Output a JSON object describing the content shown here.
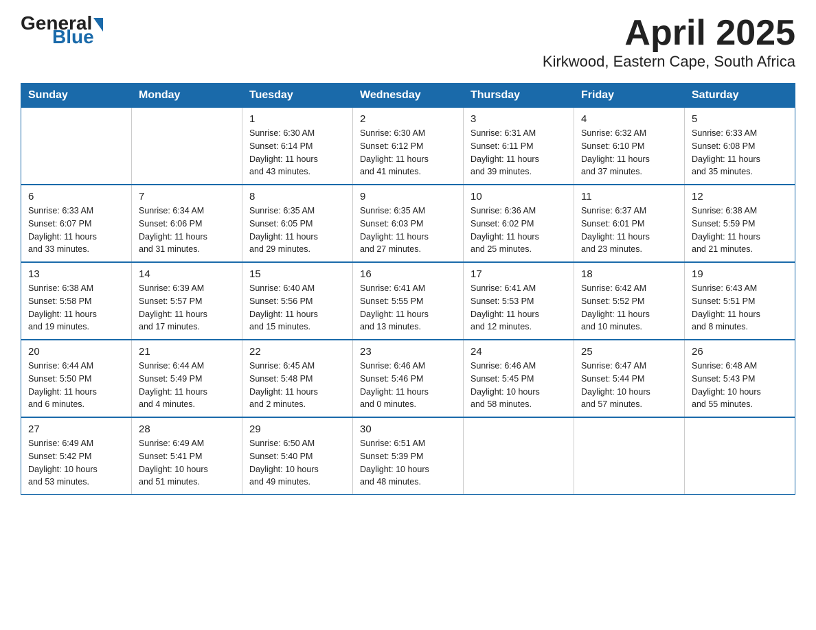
{
  "header": {
    "logo_general": "General",
    "logo_blue": "Blue",
    "title": "April 2025",
    "subtitle": "Kirkwood, Eastern Cape, South Africa"
  },
  "days": [
    "Sunday",
    "Monday",
    "Tuesday",
    "Wednesday",
    "Thursday",
    "Friday",
    "Saturday"
  ],
  "weeks": [
    [
      {
        "day": "",
        "info": ""
      },
      {
        "day": "",
        "info": ""
      },
      {
        "day": "1",
        "info": "Sunrise: 6:30 AM\nSunset: 6:14 PM\nDaylight: 11 hours\nand 43 minutes."
      },
      {
        "day": "2",
        "info": "Sunrise: 6:30 AM\nSunset: 6:12 PM\nDaylight: 11 hours\nand 41 minutes."
      },
      {
        "day": "3",
        "info": "Sunrise: 6:31 AM\nSunset: 6:11 PM\nDaylight: 11 hours\nand 39 minutes."
      },
      {
        "day": "4",
        "info": "Sunrise: 6:32 AM\nSunset: 6:10 PM\nDaylight: 11 hours\nand 37 minutes."
      },
      {
        "day": "5",
        "info": "Sunrise: 6:33 AM\nSunset: 6:08 PM\nDaylight: 11 hours\nand 35 minutes."
      }
    ],
    [
      {
        "day": "6",
        "info": "Sunrise: 6:33 AM\nSunset: 6:07 PM\nDaylight: 11 hours\nand 33 minutes."
      },
      {
        "day": "7",
        "info": "Sunrise: 6:34 AM\nSunset: 6:06 PM\nDaylight: 11 hours\nand 31 minutes."
      },
      {
        "day": "8",
        "info": "Sunrise: 6:35 AM\nSunset: 6:05 PM\nDaylight: 11 hours\nand 29 minutes."
      },
      {
        "day": "9",
        "info": "Sunrise: 6:35 AM\nSunset: 6:03 PM\nDaylight: 11 hours\nand 27 minutes."
      },
      {
        "day": "10",
        "info": "Sunrise: 6:36 AM\nSunset: 6:02 PM\nDaylight: 11 hours\nand 25 minutes."
      },
      {
        "day": "11",
        "info": "Sunrise: 6:37 AM\nSunset: 6:01 PM\nDaylight: 11 hours\nand 23 minutes."
      },
      {
        "day": "12",
        "info": "Sunrise: 6:38 AM\nSunset: 5:59 PM\nDaylight: 11 hours\nand 21 minutes."
      }
    ],
    [
      {
        "day": "13",
        "info": "Sunrise: 6:38 AM\nSunset: 5:58 PM\nDaylight: 11 hours\nand 19 minutes."
      },
      {
        "day": "14",
        "info": "Sunrise: 6:39 AM\nSunset: 5:57 PM\nDaylight: 11 hours\nand 17 minutes."
      },
      {
        "day": "15",
        "info": "Sunrise: 6:40 AM\nSunset: 5:56 PM\nDaylight: 11 hours\nand 15 minutes."
      },
      {
        "day": "16",
        "info": "Sunrise: 6:41 AM\nSunset: 5:55 PM\nDaylight: 11 hours\nand 13 minutes."
      },
      {
        "day": "17",
        "info": "Sunrise: 6:41 AM\nSunset: 5:53 PM\nDaylight: 11 hours\nand 12 minutes."
      },
      {
        "day": "18",
        "info": "Sunrise: 6:42 AM\nSunset: 5:52 PM\nDaylight: 11 hours\nand 10 minutes."
      },
      {
        "day": "19",
        "info": "Sunrise: 6:43 AM\nSunset: 5:51 PM\nDaylight: 11 hours\nand 8 minutes."
      }
    ],
    [
      {
        "day": "20",
        "info": "Sunrise: 6:44 AM\nSunset: 5:50 PM\nDaylight: 11 hours\nand 6 minutes."
      },
      {
        "day": "21",
        "info": "Sunrise: 6:44 AM\nSunset: 5:49 PM\nDaylight: 11 hours\nand 4 minutes."
      },
      {
        "day": "22",
        "info": "Sunrise: 6:45 AM\nSunset: 5:48 PM\nDaylight: 11 hours\nand 2 minutes."
      },
      {
        "day": "23",
        "info": "Sunrise: 6:46 AM\nSunset: 5:46 PM\nDaylight: 11 hours\nand 0 minutes."
      },
      {
        "day": "24",
        "info": "Sunrise: 6:46 AM\nSunset: 5:45 PM\nDaylight: 10 hours\nand 58 minutes."
      },
      {
        "day": "25",
        "info": "Sunrise: 6:47 AM\nSunset: 5:44 PM\nDaylight: 10 hours\nand 57 minutes."
      },
      {
        "day": "26",
        "info": "Sunrise: 6:48 AM\nSunset: 5:43 PM\nDaylight: 10 hours\nand 55 minutes."
      }
    ],
    [
      {
        "day": "27",
        "info": "Sunrise: 6:49 AM\nSunset: 5:42 PM\nDaylight: 10 hours\nand 53 minutes."
      },
      {
        "day": "28",
        "info": "Sunrise: 6:49 AM\nSunset: 5:41 PM\nDaylight: 10 hours\nand 51 minutes."
      },
      {
        "day": "29",
        "info": "Sunrise: 6:50 AM\nSunset: 5:40 PM\nDaylight: 10 hours\nand 49 minutes."
      },
      {
        "day": "30",
        "info": "Sunrise: 6:51 AM\nSunset: 5:39 PM\nDaylight: 10 hours\nand 48 minutes."
      },
      {
        "day": "",
        "info": ""
      },
      {
        "day": "",
        "info": ""
      },
      {
        "day": "",
        "info": ""
      }
    ]
  ]
}
